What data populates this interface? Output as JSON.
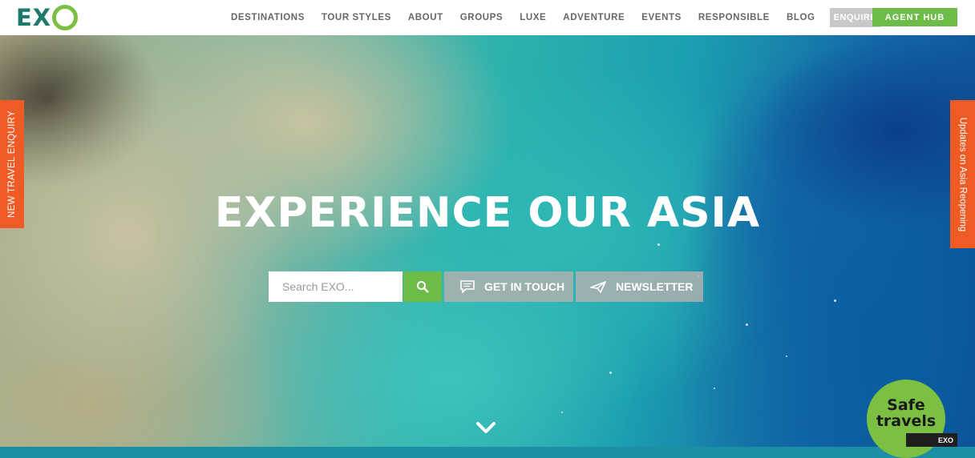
{
  "brand": {
    "logo_text": "EX"
  },
  "nav": {
    "items": [
      {
        "label": "DESTINATIONS"
      },
      {
        "label": "TOUR STYLES"
      },
      {
        "label": "ABOUT"
      },
      {
        "label": "GROUPS"
      },
      {
        "label": "LUXE"
      },
      {
        "label": "ADVENTURE"
      },
      {
        "label": "EVENTS"
      },
      {
        "label": "RESPONSIBLE"
      },
      {
        "label": "BLOG"
      }
    ],
    "enquire_label": "ENQUIRE",
    "search_icon": "search-icon",
    "agent_hub_label": "AGENT HUB"
  },
  "side_tabs": {
    "left_label": "NEW TRAVEL ENQUIRY",
    "right_label": "Updates on Asia Reopening"
  },
  "hero": {
    "title": "EXPERIENCE OUR ASIA",
    "search_placeholder": "Search EXO...",
    "get_in_touch_label": "GET IN TOUCH",
    "newsletter_label": "NEWSLETTER"
  },
  "badge": {
    "line1": "Safe",
    "line2": "travels",
    "corner_text": "EXO"
  },
  "colors": {
    "brand_green": "#6dbb48",
    "brand_teal": "#1e7a6a",
    "accent_orange": "#f05a24",
    "enquire_grey": "#c8c8c8"
  }
}
